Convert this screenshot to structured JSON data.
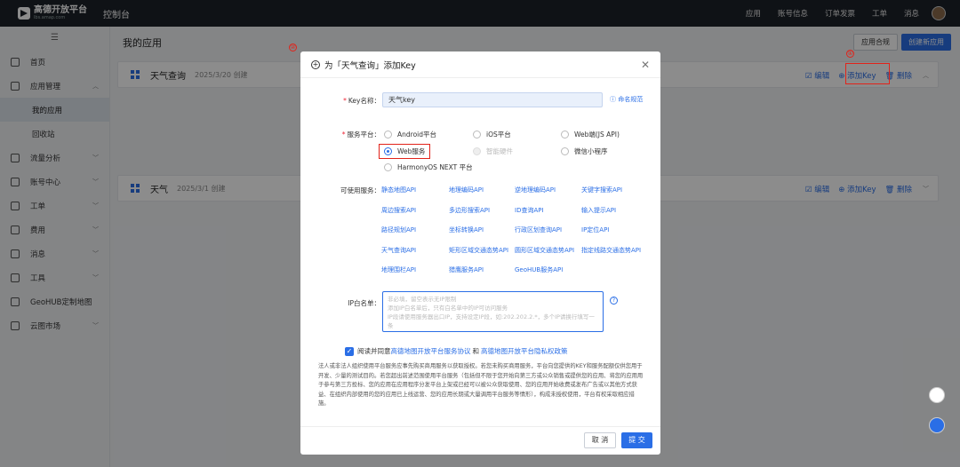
{
  "header": {
    "logo_text": "高德开放平台",
    "logo_sub": "lbs.amap.com",
    "console_title": "控制台",
    "nav": [
      "应用",
      "账号信息",
      "订单发票",
      "工单",
      "消息"
    ]
  },
  "sidebar": {
    "collapse_icon": "menu-icon",
    "items": [
      {
        "label": "首页",
        "icon": "home-icon"
      },
      {
        "label": "应用管理",
        "icon": "app-grid-icon",
        "expanded": true
      },
      {
        "label": "流量分析",
        "icon": "chart-icon"
      },
      {
        "label": "账号中心",
        "icon": "user-icon"
      },
      {
        "label": "工单",
        "icon": "ticket-icon"
      },
      {
        "label": "费用",
        "icon": "bill-icon"
      },
      {
        "label": "消息",
        "icon": "message-icon"
      },
      {
        "label": "工具",
        "icon": "tool-icon"
      },
      {
        "label": "GeoHUB定制地图",
        "icon": "layers-icon"
      },
      {
        "label": "云图市场",
        "icon": "store-icon"
      }
    ],
    "sub_items": [
      "我的应用",
      "回收站"
    ]
  },
  "main": {
    "title": "我的应用",
    "compliance_button": "应用合规",
    "create_button": "创建新应用",
    "apps": [
      {
        "name": "天气查询",
        "date": "2025/3/20 创建"
      },
      {
        "name": "天气",
        "date": "2025/3/1 创建"
      }
    ],
    "actions": {
      "edit": "编辑",
      "add_key": "添加Key",
      "delete": "删除"
    }
  },
  "modal": {
    "title": "为「天气查询」添加Key",
    "key_name_label": "Key名称：",
    "key_name_value": "天气key",
    "naming_rule_link": "命名规范",
    "platform_label": "服务平台：",
    "platforms": [
      "Android平台",
      "iOS平台",
      "Web端(JS API)",
      "Web服务",
      "智能硬件",
      "微信小程序",
      "HarmonyOS NEXT 平台"
    ],
    "selected_platform": "Web服务",
    "services_label": "可使用服务：",
    "apis": [
      "静态地图API",
      "地理编码API",
      "逆地理编码API",
      "关键字搜索API",
      "周边搜索API",
      "多边形搜索API",
      "ID查询API",
      "输入提示API",
      "路径规划API",
      "坐标转换API",
      "行政区划查询API",
      "IP定位API",
      "天气查询API",
      "矩形区域交通态势API",
      "圆形区域交通态势API",
      "指定线路交通态势API",
      "地理围栏API",
      "猎鹰服务API",
      "GeoHUB服务API"
    ],
    "ip_label": "IP白名单：",
    "ip_placeholder": "非必填，留空表示无IP限制\n添加IP白名单后，只有白名单中的IP可访问服务\nIP段请使用服务器出口IP，支持设定IP段，如:202.202.2.*，多个IP请换行填写一条",
    "agree_prefix": "阅读并同意",
    "agree_link1": "高德地图开放平台服务协议",
    "agree_and": "和",
    "agree_link2": "高德地图开放平台隐私权政策",
    "legal_text": "法人或非法人组织使用平台服务应事先购买商用服务以获取授权。若您未购买商用服务，平台向您提供的KEY和服务配额仅供您用于开发、少量的测试目的。若您超出前述范围使用平台服务（包括但不限于您开始向第三方或公众销售或提供您的应用、将您的应用用于参与第三方投标、您的应用在应用程序分发平台上架或已经可以被公众获取使用、您的应用开始收费或发布广告或以其他方式获益、在组织内部使用的您的应用已上线运营、您的应用长期或大量调用平台服务等情形），构成未授权使用，平台有权采取相应措施。",
    "cancel": "取 消",
    "submit": "提 交"
  },
  "annotations": {
    "one": "①",
    "two": "②"
  }
}
